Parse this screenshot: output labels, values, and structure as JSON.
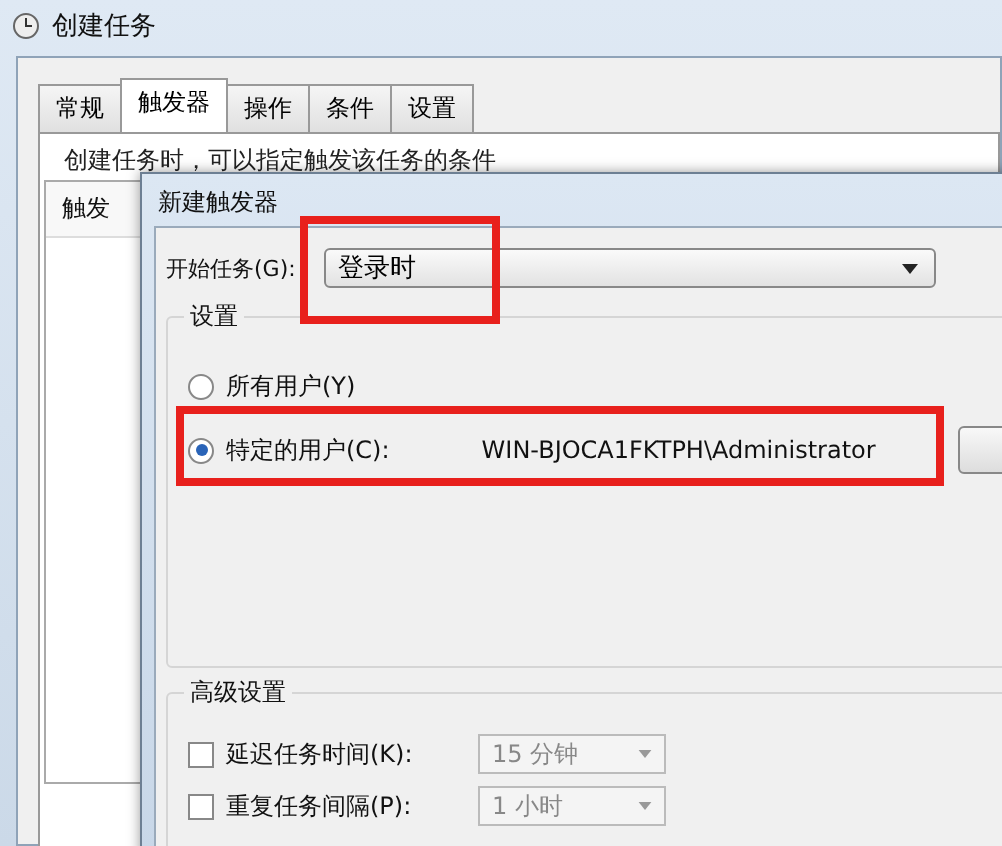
{
  "window": {
    "title": "创建任务"
  },
  "tabs": [
    {
      "label": "常规",
      "selected": false
    },
    {
      "label": "触发器",
      "selected": true
    },
    {
      "label": "操作",
      "selected": false
    },
    {
      "label": "条件",
      "selected": false
    },
    {
      "label": "设置",
      "selected": false
    }
  ],
  "description": "创建任务时，可以指定触发该任务的条件",
  "list": {
    "column_1": "触发"
  },
  "dialog": {
    "title": "新建触发器",
    "start": {
      "label": "开始任务(G):",
      "value": "登录时"
    },
    "settings": {
      "title": "设置",
      "options": [
        {
          "label": "所有用户(Y)",
          "selected": false
        },
        {
          "label": "特定的用户(C):",
          "selected": true,
          "user": "WIN-BJOCA1FKTPH\\Administrator"
        }
      ]
    },
    "advanced": {
      "title": "高级设置",
      "rows": [
        {
          "label": "延迟任务时间(K):",
          "checked": false,
          "value": "15 分钟"
        },
        {
          "label": "重复任务间隔(P):",
          "checked": false,
          "value": "1 小时"
        }
      ]
    }
  }
}
